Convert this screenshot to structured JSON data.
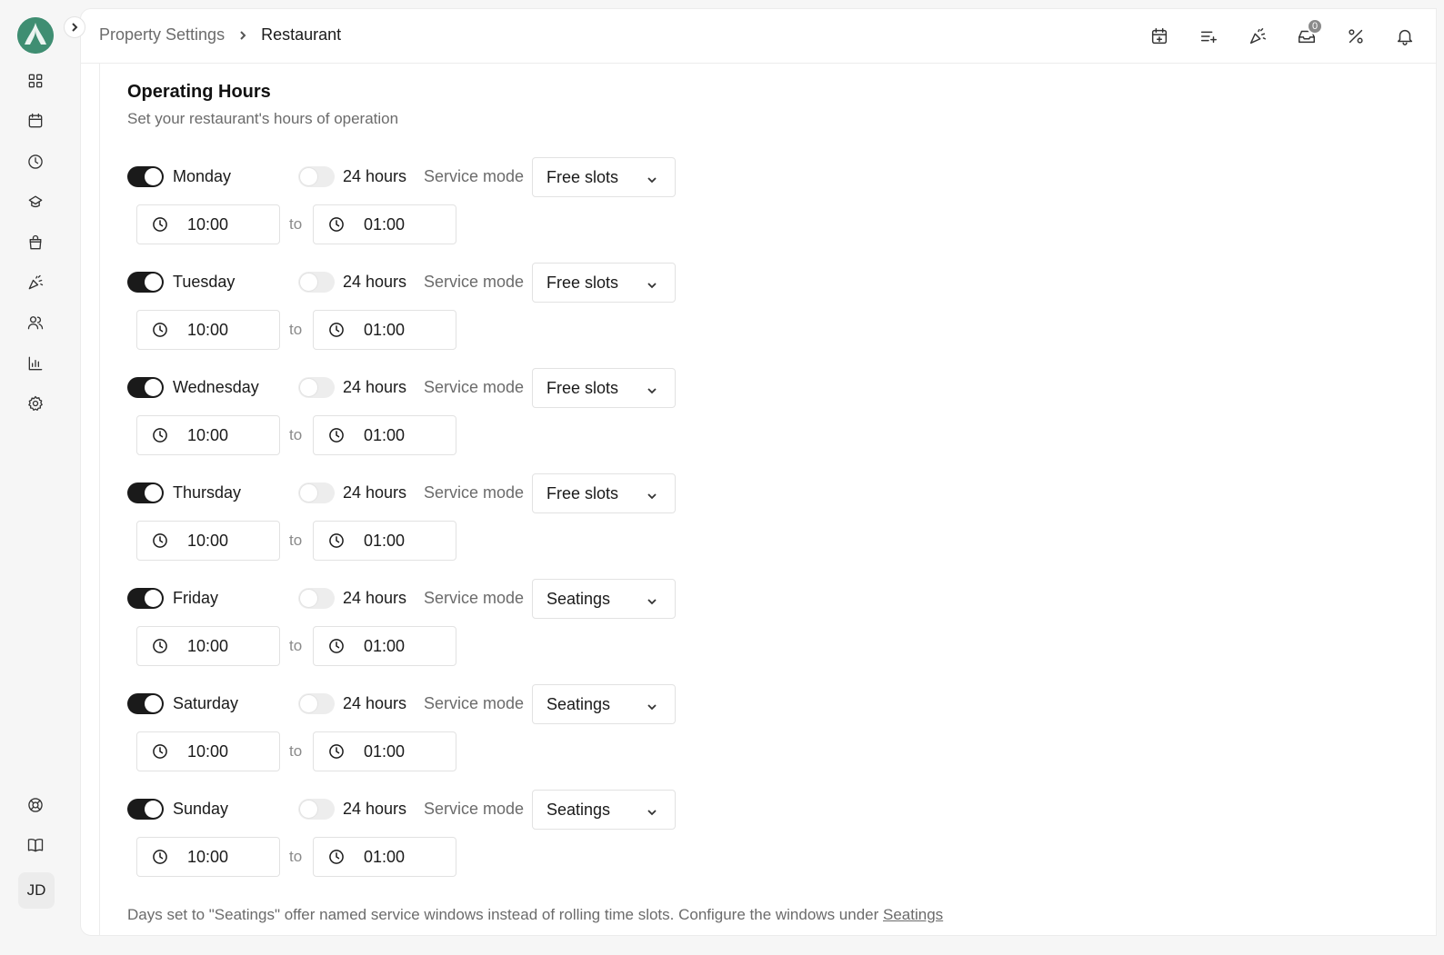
{
  "sidebar": {
    "logo": "brand-logo",
    "collapse_icon": "chevron-right-icon",
    "nav_icons": [
      "grid-icon",
      "calendar-icon",
      "clock-icon",
      "chef-hat-icon",
      "bag-icon",
      "party-icon",
      "users-icon",
      "chart-icon",
      "settings-icon"
    ],
    "bottom_icons": [
      "help-icon",
      "book-icon"
    ],
    "avatar_initials": "JD"
  },
  "header": {
    "breadcrumb_parent": "Property Settings",
    "breadcrumb_current": "Restaurant",
    "icons": [
      "calendar-plus-icon",
      "list-add-icon",
      "party-popper-icon",
      "inbox-icon",
      "discount-icon",
      "bell-icon"
    ],
    "inbox_count": "0"
  },
  "section": {
    "title": "Operating Hours",
    "subtitle": "Set your restaurant's hours of operation"
  },
  "labels": {
    "hours24": "24 hours",
    "service_mode": "Service mode",
    "to": "to"
  },
  "days": [
    {
      "name": "Monday",
      "enabled": true,
      "h24": false,
      "mode": "Free slots",
      "from": "10:00",
      "to": "01:00"
    },
    {
      "name": "Tuesday",
      "enabled": true,
      "h24": false,
      "mode": "Free slots",
      "from": "10:00",
      "to": "01:00"
    },
    {
      "name": "Wednesday",
      "enabled": true,
      "h24": false,
      "mode": "Free slots",
      "from": "10:00",
      "to": "01:00"
    },
    {
      "name": "Thursday",
      "enabled": true,
      "h24": false,
      "mode": "Free slots",
      "from": "10:00",
      "to": "01:00"
    },
    {
      "name": "Friday",
      "enabled": true,
      "h24": false,
      "mode": "Seatings",
      "from": "10:00",
      "to": "01:00"
    },
    {
      "name": "Saturday",
      "enabled": true,
      "h24": false,
      "mode": "Seatings",
      "from": "10:00",
      "to": "01:00"
    },
    {
      "name": "Sunday",
      "enabled": true,
      "h24": false,
      "mode": "Seatings",
      "from": "10:00",
      "to": "01:00"
    }
  ],
  "footnote": {
    "text": "Days set to \"Seatings\" offer named service windows instead of rolling time slots. Configure the windows under ",
    "link": "Seatings"
  },
  "colors": {
    "toggle_on": "#1a1a1a",
    "toggle_off": "#ededed",
    "logo_bg": "#3a8a6e"
  }
}
